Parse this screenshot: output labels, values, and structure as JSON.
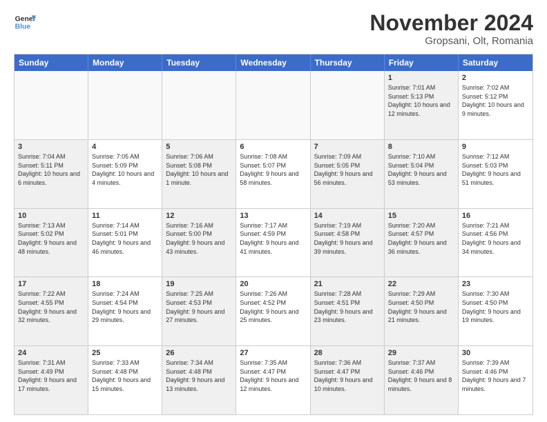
{
  "header": {
    "logo_general": "General",
    "logo_blue": "Blue",
    "month_title": "November 2024",
    "location": "Gropsani, Olt, Romania"
  },
  "weekdays": [
    "Sunday",
    "Monday",
    "Tuesday",
    "Wednesday",
    "Thursday",
    "Friday",
    "Saturday"
  ],
  "rows": [
    [
      {
        "day": "",
        "empty": true
      },
      {
        "day": "",
        "empty": true
      },
      {
        "day": "",
        "empty": true
      },
      {
        "day": "",
        "empty": true
      },
      {
        "day": "",
        "empty": true
      },
      {
        "day": "1",
        "info": "Sunrise: 7:01 AM\nSunset: 5:13 PM\nDaylight: 10 hours and 12 minutes.",
        "shaded": true
      },
      {
        "day": "2",
        "info": "Sunrise: 7:02 AM\nSunset: 5:12 PM\nDaylight: 10 hours and 9 minutes.",
        "shaded": false
      }
    ],
    [
      {
        "day": "3",
        "info": "Sunrise: 7:04 AM\nSunset: 5:11 PM\nDaylight: 10 hours and 6 minutes.",
        "shaded": true
      },
      {
        "day": "4",
        "info": "Sunrise: 7:05 AM\nSunset: 5:09 PM\nDaylight: 10 hours and 4 minutes.",
        "shaded": false
      },
      {
        "day": "5",
        "info": "Sunrise: 7:06 AM\nSunset: 5:08 PM\nDaylight: 10 hours and 1 minute.",
        "shaded": true
      },
      {
        "day": "6",
        "info": "Sunrise: 7:08 AM\nSunset: 5:07 PM\nDaylight: 9 hours and 58 minutes.",
        "shaded": false
      },
      {
        "day": "7",
        "info": "Sunrise: 7:09 AM\nSunset: 5:05 PM\nDaylight: 9 hours and 56 minutes.",
        "shaded": true
      },
      {
        "day": "8",
        "info": "Sunrise: 7:10 AM\nSunset: 5:04 PM\nDaylight: 9 hours and 53 minutes.",
        "shaded": true
      },
      {
        "day": "9",
        "info": "Sunrise: 7:12 AM\nSunset: 5:03 PM\nDaylight: 9 hours and 51 minutes.",
        "shaded": false
      }
    ],
    [
      {
        "day": "10",
        "info": "Sunrise: 7:13 AM\nSunset: 5:02 PM\nDaylight: 9 hours and 48 minutes.",
        "shaded": true
      },
      {
        "day": "11",
        "info": "Sunrise: 7:14 AM\nSunset: 5:01 PM\nDaylight: 9 hours and 46 minutes.",
        "shaded": false
      },
      {
        "day": "12",
        "info": "Sunrise: 7:16 AM\nSunset: 5:00 PM\nDaylight: 9 hours and 43 minutes.",
        "shaded": true
      },
      {
        "day": "13",
        "info": "Sunrise: 7:17 AM\nSunset: 4:59 PM\nDaylight: 9 hours and 41 minutes.",
        "shaded": false
      },
      {
        "day": "14",
        "info": "Sunrise: 7:19 AM\nSunset: 4:58 PM\nDaylight: 9 hours and 39 minutes.",
        "shaded": true
      },
      {
        "day": "15",
        "info": "Sunrise: 7:20 AM\nSunset: 4:57 PM\nDaylight: 9 hours and 36 minutes.",
        "shaded": true
      },
      {
        "day": "16",
        "info": "Sunrise: 7:21 AM\nSunset: 4:56 PM\nDaylight: 9 hours and 34 minutes.",
        "shaded": false
      }
    ],
    [
      {
        "day": "17",
        "info": "Sunrise: 7:22 AM\nSunset: 4:55 PM\nDaylight: 9 hours and 32 minutes.",
        "shaded": true
      },
      {
        "day": "18",
        "info": "Sunrise: 7:24 AM\nSunset: 4:54 PM\nDaylight: 9 hours and 29 minutes.",
        "shaded": false
      },
      {
        "day": "19",
        "info": "Sunrise: 7:25 AM\nSunset: 4:53 PM\nDaylight: 9 hours and 27 minutes.",
        "shaded": true
      },
      {
        "day": "20",
        "info": "Sunrise: 7:26 AM\nSunset: 4:52 PM\nDaylight: 9 hours and 25 minutes.",
        "shaded": false
      },
      {
        "day": "21",
        "info": "Sunrise: 7:28 AM\nSunset: 4:51 PM\nDaylight: 9 hours and 23 minutes.",
        "shaded": true
      },
      {
        "day": "22",
        "info": "Sunrise: 7:29 AM\nSunset: 4:50 PM\nDaylight: 9 hours and 21 minutes.",
        "shaded": true
      },
      {
        "day": "23",
        "info": "Sunrise: 7:30 AM\nSunset: 4:50 PM\nDaylight: 9 hours and 19 minutes.",
        "shaded": false
      }
    ],
    [
      {
        "day": "24",
        "info": "Sunrise: 7:31 AM\nSunset: 4:49 PM\nDaylight: 9 hours and 17 minutes.",
        "shaded": true
      },
      {
        "day": "25",
        "info": "Sunrise: 7:33 AM\nSunset: 4:48 PM\nDaylight: 9 hours and 15 minutes.",
        "shaded": false
      },
      {
        "day": "26",
        "info": "Sunrise: 7:34 AM\nSunset: 4:48 PM\nDaylight: 9 hours and 13 minutes.",
        "shaded": true
      },
      {
        "day": "27",
        "info": "Sunrise: 7:35 AM\nSunset: 4:47 PM\nDaylight: 9 hours and 12 minutes.",
        "shaded": false
      },
      {
        "day": "28",
        "info": "Sunrise: 7:36 AM\nSunset: 4:47 PM\nDaylight: 9 hours and 10 minutes.",
        "shaded": true
      },
      {
        "day": "29",
        "info": "Sunrise: 7:37 AM\nSunset: 4:46 PM\nDaylight: 9 hours and 8 minutes.",
        "shaded": true
      },
      {
        "day": "30",
        "info": "Sunrise: 7:39 AM\nSunset: 4:46 PM\nDaylight: 9 hours and 7 minutes.",
        "shaded": false
      }
    ]
  ]
}
